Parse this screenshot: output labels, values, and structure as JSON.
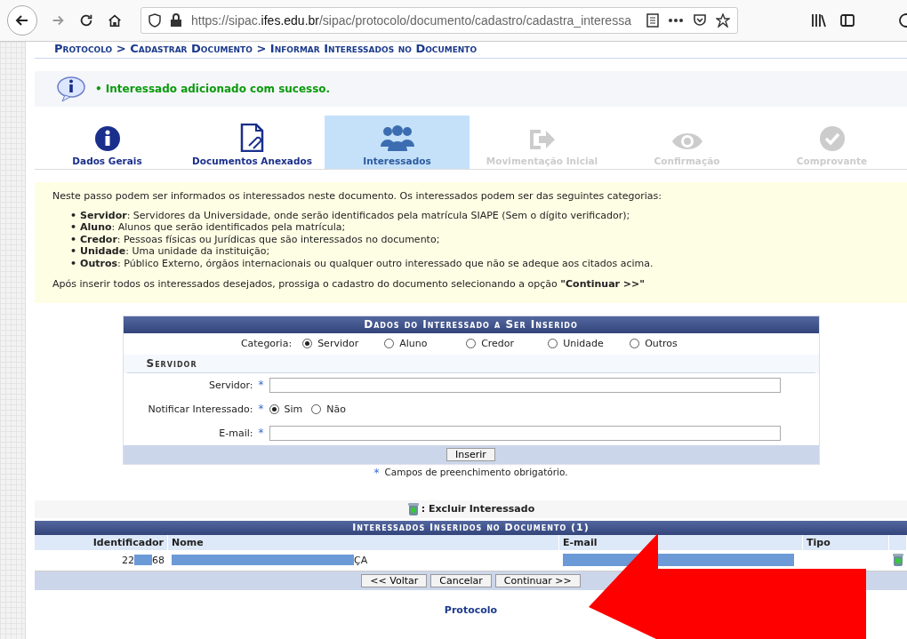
{
  "browser": {
    "url_host": "https://sipac.",
    "url_domain": "ifes.edu.br",
    "url_path": "/sipac/protocolo/documento/cadastro/cadastra_interessa"
  },
  "breadcrumb": "Protocolo > Cadastrar Documento > Informar Interessados no Documento",
  "message": "• Interessado adicionado com sucesso.",
  "steps": [
    {
      "label": "Dados Gerais",
      "kind": "info",
      "selected": false,
      "disabled": false
    },
    {
      "label": "Documentos Anexados",
      "kind": "doc",
      "selected": false,
      "disabled": false
    },
    {
      "label": "Interessados",
      "kind": "people",
      "selected": true,
      "disabled": false
    },
    {
      "label": "Movimentação Inicial",
      "kind": "move",
      "selected": false,
      "disabled": true
    },
    {
      "label": "Confirmação",
      "kind": "eye",
      "selected": false,
      "disabled": true
    },
    {
      "label": "Comprovante",
      "kind": "check",
      "selected": false,
      "disabled": true
    }
  ],
  "help": {
    "intro": "Neste passo podem ser informados os interessados neste documento. Os interessados podem ser das seguintes categorias:",
    "bullet": "•",
    "items": [
      "**Servidor**: Servidores da Universidade, onde serão identificados pela matrícula SIAPE (Sem o dígito verificador);",
      "**Aluno**: Alunos que serão identificados pela matrícula;",
      "**Credor**: Pessoas físicas ou Jurídicas que são interessados no documento;",
      "**Unidade**: Uma unidade da instituição;",
      "**Outros**: Público Externo, órgãos internacionais ou qualquer outro interessado que não se adeque aos citados acima."
    ],
    "outro": "Após inserir todos os interessados desejados, prossiga o cadastro do documento selecionando a opção **\"Continuar >>\"**"
  },
  "form": {
    "title": "Dados do Interessado a Ser Inserido",
    "category_label": "Categoria:",
    "categories": [
      {
        "label": "Servidor",
        "selected": true
      },
      {
        "label": "Aluno",
        "selected": false
      },
      {
        "label": "Credor",
        "selected": false
      },
      {
        "label": "Unidade",
        "selected": false
      },
      {
        "label": "Outros",
        "selected": false
      }
    ],
    "section": "Servidor",
    "servidor_label": "Servidor:",
    "notify_label": "Notificar Interessado:",
    "notify_options": [
      {
        "label": "Sim",
        "selected": true
      },
      {
        "label": "Não",
        "selected": false
      }
    ],
    "email_label": "E-mail:",
    "required_mark": "*",
    "insert_button": "Inserir",
    "required_note": "Campos de preenchimento obrigatório."
  },
  "delete_legend": ": Excluir Interessado",
  "table": {
    "title": "Interessados Inseridos no Documento (1)",
    "columns": [
      "Identificador",
      "Nome",
      "E-mail",
      "Tipo"
    ],
    "rows": [
      {
        "id_start": "22",
        "id_end": "68",
        "name_end": "ÇA"
      }
    ]
  },
  "buttons": [
    "<< Voltar",
    "Cancelar",
    "Continuar >>"
  ],
  "footer": "Protocolo"
}
